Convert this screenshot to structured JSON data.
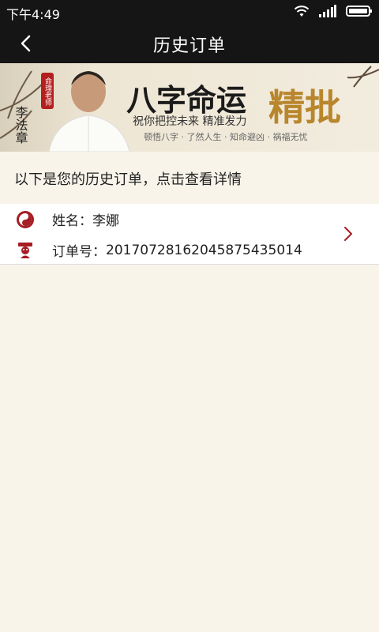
{
  "status_bar": {
    "time": "下午4:49",
    "icons": [
      "wifi-icon",
      "signal-icon",
      "battery-icon"
    ]
  },
  "header": {
    "title": "历史订单",
    "back_icon": "chevron-left-icon"
  },
  "banner": {
    "name": "李法章",
    "role": "命理老师",
    "headline": "八字命运",
    "highlight": "精批",
    "slogan": "祝你把控未来 精准发力",
    "tagline": "顿悟八字 · 了然人生 · 知命避凶 · 祸福无忧"
  },
  "intro_text": "以下是您的历史订单，点击查看详情",
  "order": {
    "name_label": "姓名：",
    "name_value": "李娜",
    "order_label": "订单号：",
    "order_value": "20170728162045875435014",
    "icons": [
      "yinyang-icon",
      "fortune-god-icon",
      "chevron-right-icon"
    ]
  },
  "colors": {
    "bar_bg": "#151515",
    "page_bg": "#f8f4ea",
    "accent": "#a61d24",
    "gold": "#b8862c"
  }
}
